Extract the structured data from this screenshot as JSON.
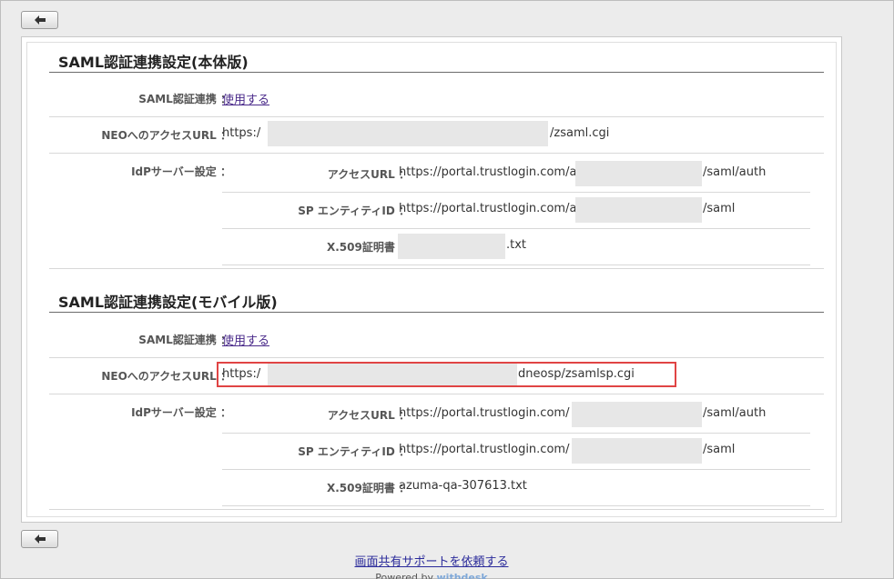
{
  "buttons": {
    "back_icon": "arrow-left-icon"
  },
  "sections": [
    {
      "title": "SAML認証連携設定(本体版)",
      "saml_label": "SAML認証連携 ：",
      "saml_value": "使用する",
      "neo_url_label": "NEOへのアクセスURL ：",
      "neo_url_prefix": "https:/",
      "neo_url_suffix": "/zsaml.cgi",
      "idp_label": "IdPサーバー設定 ：",
      "access_url_label": "アクセスURL ：",
      "access_url_prefix": "https://portal.trustlogin.com/a",
      "access_url_suffix": "/saml/auth",
      "sp_entity_label": "SP エンティティID ：",
      "sp_entity_prefix": "https://portal.trustlogin.com/a",
      "sp_entity_suffix": "/saml",
      "cert_label": "X.509証明書 ：",
      "cert_value": ".txt"
    },
    {
      "title": "SAML認証連携設定(モバイル版)",
      "saml_label": "SAML認証連携 ：",
      "saml_value": "使用する",
      "neo_url_label": "NEOへのアクセスURL ：",
      "neo_url_prefix": "https:/",
      "neo_url_suffix": "dneosp/zsamlsp.cgi",
      "idp_label": "IdPサーバー設定 ：",
      "access_url_label": "アクセスURL ：",
      "access_url_prefix": "https://portal.trustlogin.com/",
      "access_url_suffix": "/saml/auth",
      "sp_entity_label": "SP エンティティID ：",
      "sp_entity_prefix": "https://portal.trustlogin.com/",
      "sp_entity_suffix": "/saml",
      "cert_label": "X.509証明書 ：",
      "cert_value": "azuma-qa-307613.txt"
    }
  ],
  "footer": {
    "support_link": "画面共有サポートを依頼する",
    "powered_by": "Powered by",
    "brand": "withdesk"
  },
  "colors": {
    "highlight": "#e04444",
    "link": "#4a2a8a"
  }
}
